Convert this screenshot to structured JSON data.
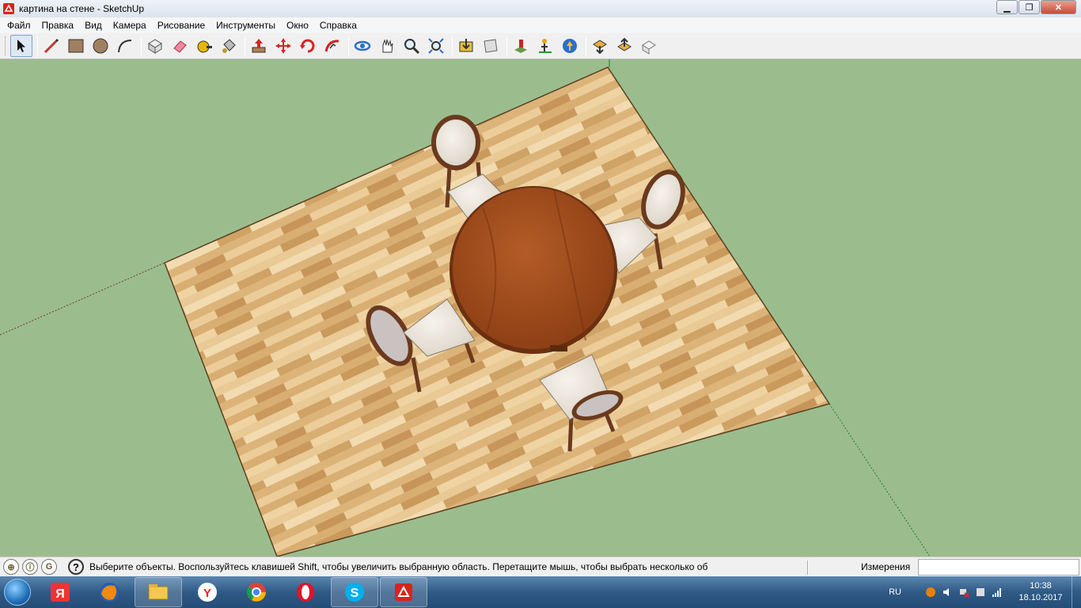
{
  "window": {
    "title": "картина на стене - SketchUp",
    "minimize_label": "▁",
    "maximize_label": "❐",
    "close_label": "✕"
  },
  "menu": {
    "items": [
      "Файл",
      "Правка",
      "Вид",
      "Камера",
      "Рисование",
      "Инструменты",
      "Окно",
      "Справка"
    ]
  },
  "toolbar": {
    "tools": [
      "select-tool-icon",
      "pencil-line-icon",
      "rectangle-icon",
      "circle-icon",
      "arc-icon",
      "make-component-icon",
      "eraser-icon",
      "tape-measure-icon",
      "paint-bucket-icon",
      "push-pull-icon",
      "move-icon",
      "rotate-icon",
      "follow-me-icon",
      "orbit-icon",
      "pan-icon",
      "zoom-icon",
      "zoom-extents-icon",
      "3d-warehouse-icon",
      "extension-warehouse-icon",
      "add-location-icon",
      "toggle-terrain-icon",
      "google-earth-icon",
      "get-models-icon",
      "share-model-icon",
      "share-component-icon"
    ]
  },
  "status": {
    "hint": "Выберите объекты. Воспользуйтесь клавишей Shift, чтобы увеличить выбранную область. Перетащите мышь, чтобы выбрать несколько об",
    "measure_label": "Измерения",
    "measure_value": ""
  },
  "taskbar": {
    "apps": [
      "yandex-icon",
      "firefox-icon",
      "file-explorer-icon",
      "yandex-browser-icon",
      "chrome-icon",
      "opera-icon",
      "skype-icon",
      "sketchup-icon"
    ],
    "lang": "RU",
    "time": "10:38",
    "date": "18.10.2017"
  },
  "colors": {
    "viewport_bg": "#9bbd8e",
    "floor_light": "#e8c58d",
    "table_wood": "#9b4a1c",
    "chair_frame": "#6b3a1e"
  }
}
